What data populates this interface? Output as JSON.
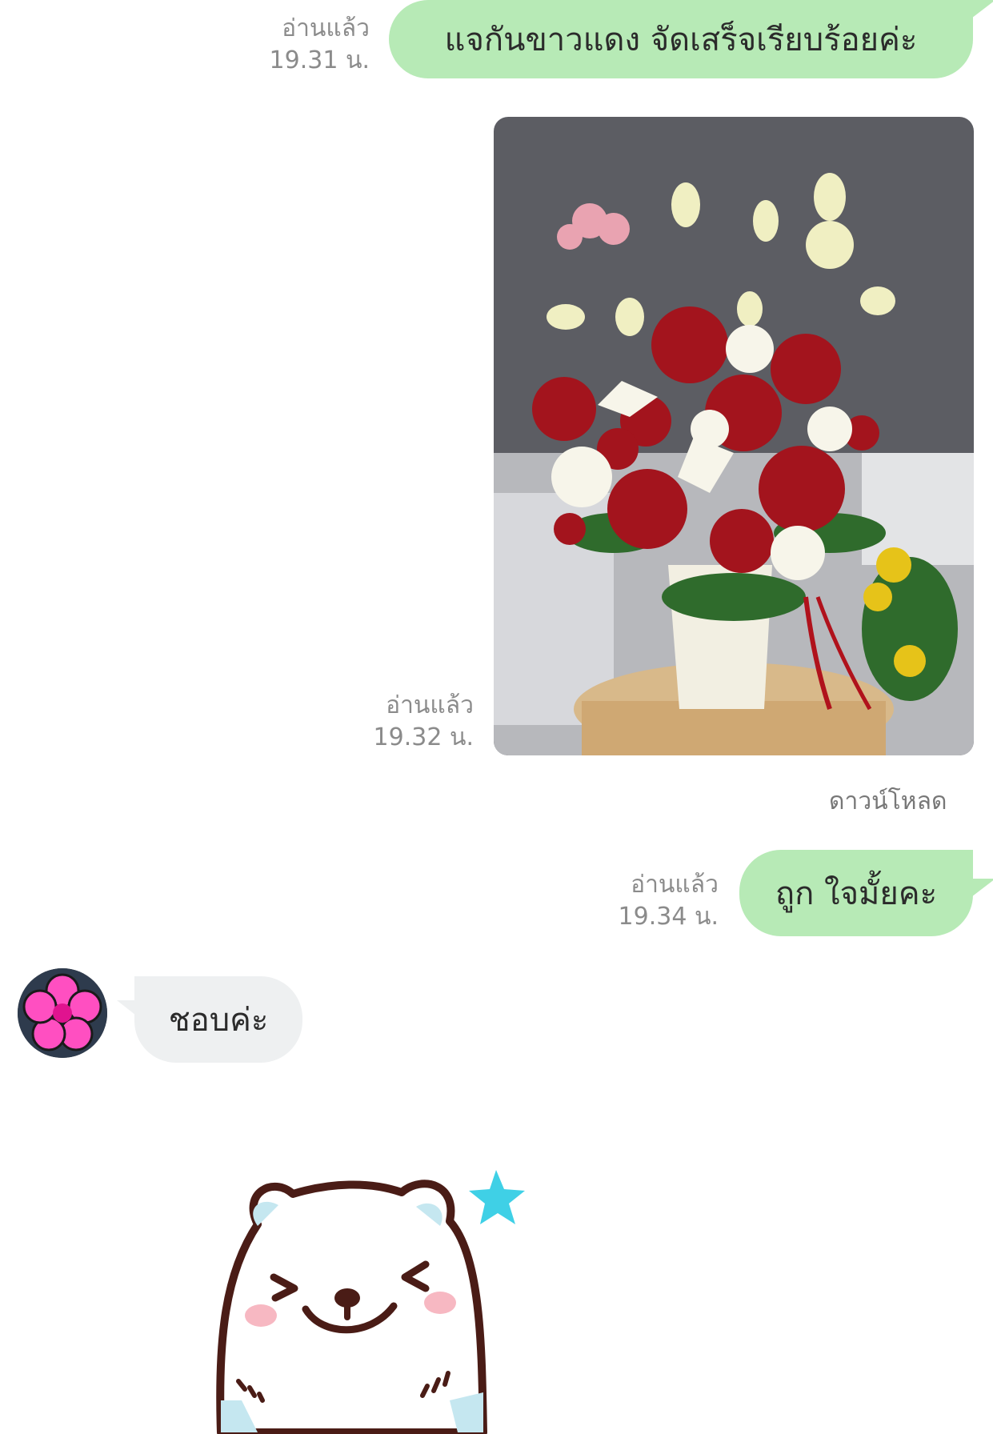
{
  "messages": [
    {
      "side": "out",
      "type": "text",
      "text": "แจกันขาวแดง จัดเสร็จเรียบร้อยค่ะ",
      "status": "อ่านแล้ว",
      "time": "19.31 น."
    },
    {
      "side": "out",
      "type": "image",
      "status": "อ่านแล้ว",
      "time": "19.32 น.",
      "download_label": "ดาวน์โหลด"
    },
    {
      "side": "out",
      "type": "text",
      "text": "ถูก ใจมั้ยคะ",
      "status": "อ่านแล้ว",
      "time": "19.34 น."
    },
    {
      "side": "in",
      "type": "text",
      "text": "ชอบค่ะ"
    },
    {
      "side": "in",
      "type": "sticker"
    }
  ],
  "icons": {
    "avatar": "pink-flower-avatar",
    "sticker": "white-bear-sticker"
  },
  "colors": {
    "outgoing_bubble": "#b7eab6",
    "incoming_bubble": "#eef0f1",
    "meta_text": "#8b8b8b"
  }
}
